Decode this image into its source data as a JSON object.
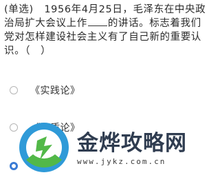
{
  "question": {
    "type_label": "(单选)",
    "text_before_blank": "1956年4月25日，毛泽东在中央政治局扩大会议上作",
    "text_after_blank": "的讲话。标志着我们党对怎样建设社会主义有了自己新的重要认识。（　）"
  },
  "options": [
    {
      "label": "《实践论》",
      "selected": false
    },
    {
      "label": "《矛盾论》",
      "selected": false
    },
    {
      "label": "",
      "selected": true
    }
  ],
  "watermark": {
    "title": "金烨攻略网",
    "url": "www.jykz.com.cn",
    "colors": {
      "logo_blue": "#2f9ad8",
      "logo_green": "#52b848",
      "text": "#2f3c50"
    }
  },
  "colors": {
    "radio_selected": "#3a7bd5",
    "radio_border": "#b5b5b5",
    "text": "#333333"
  }
}
